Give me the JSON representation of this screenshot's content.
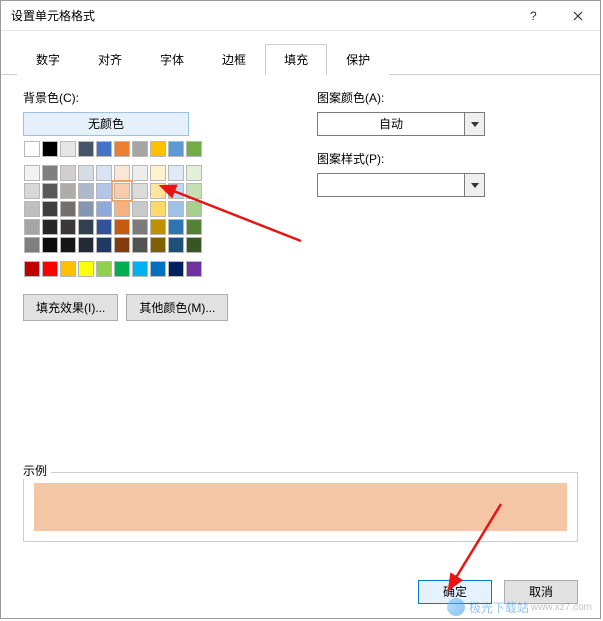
{
  "title": "设置单元格格式",
  "tabs": [
    "数字",
    "对齐",
    "字体",
    "边框",
    "填充",
    "保护"
  ],
  "active_tab_index": 4,
  "labels": {
    "bgcolor": "背景色(C):",
    "nocolor": "无颜色",
    "fill_effects": "填充效果(I)...",
    "more_colors": "其他颜色(M)...",
    "pattern_color": "图案颜色(A):",
    "auto": "自动",
    "pattern_style": "图案样式(P):",
    "sample": "示例"
  },
  "swatch_row1": [
    "#ffffff",
    "#000000",
    "#e7e6e6",
    "#44546a",
    "#4472c4",
    "#ed7d31",
    "#a5a5a5",
    "#ffc000",
    "#5b9bd5",
    "#70ad47"
  ],
  "swatch_grid": [
    [
      "#f2f2f2",
      "#7f7f7f",
      "#d0cece",
      "#d6dce4",
      "#d9e2f3",
      "#fbe5d5",
      "#ededed",
      "#fff2cc",
      "#deebf6",
      "#e2efd9"
    ],
    [
      "#d8d8d8",
      "#595959",
      "#aeabab",
      "#adb9ca",
      "#b4c6e7",
      "#f7cbac",
      "#dbdbdb",
      "#fee599",
      "#bdd7ee",
      "#c5e0b3"
    ],
    [
      "#bfbfbf",
      "#3f3f3f",
      "#757070",
      "#8496b0",
      "#8eaadb",
      "#f4b183",
      "#c9c9c9",
      "#ffd965",
      "#9cc3e5",
      "#a8d08d"
    ],
    [
      "#a5a5a5",
      "#262626",
      "#3a3838",
      "#323f4f",
      "#2f5496",
      "#c55a11",
      "#7b7b7b",
      "#bf9000",
      "#2e75b5",
      "#538135"
    ],
    [
      "#7f7f7f",
      "#0c0c0c",
      "#171616",
      "#222a35",
      "#1f3864",
      "#833c0b",
      "#525252",
      "#7f6000",
      "#1e4e79",
      "#375623"
    ]
  ],
  "swatch_standard": [
    "#c00000",
    "#ff0000",
    "#ffc000",
    "#ffff00",
    "#92d050",
    "#00b050",
    "#00b0f0",
    "#0070c0",
    "#002060",
    "#7030a0"
  ],
  "selected_swatch": {
    "row": 1,
    "col": 5
  },
  "sample_color": "#f5c6a5",
  "pattern_color_value": "自动",
  "pattern_style_value": "",
  "buttons": {
    "ok": "确定",
    "cancel": "取消"
  },
  "watermark": {
    "brand": "极光下载站",
    "url": "www.xz7.com"
  }
}
